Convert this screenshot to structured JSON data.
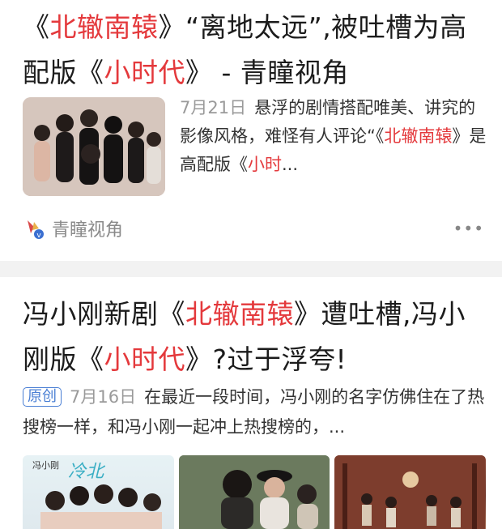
{
  "card1": {
    "title": {
      "p1": "《",
      "h1": "北辙南辕",
      "p2": "》“离地太远”,被吐槽为高配版《",
      "h2": "小时代",
      "p3": "》 - 青瞳视角"
    },
    "date": "7月21日",
    "snippet": {
      "s1": "悬浮的剧情搭配唯美、讲究的影像风格，难怪有人评论“《",
      "h1": "北辙南辕",
      "s2": "》是高配版《",
      "h2": "小时",
      "s3": "..."
    },
    "source": "青瞳视角",
    "more_label": "•••",
    "thumbnail_icon": "poster-photo"
  },
  "card2": {
    "title": {
      "p1": "冯小刚新剧《",
      "h1": "北辙南辕",
      "p2": "》遭吐槽,冯小刚版《",
      "h2": "小时代",
      "p3": "》?过于浮夸!"
    },
    "badge": "原创",
    "date": "7月16日",
    "snippet": "在最近一段时间，冯小刚的名字仿佛住在了热搜榜一样，和冯小刚一起冲上热搜榜的，...",
    "images": [
      "poster-photo",
      "still-photo",
      "still-photo"
    ],
    "poster_caption": "冯小刚"
  },
  "colors": {
    "highlight": "#e4393c",
    "badge": "#4a7fd4",
    "meta": "#9a9a9a",
    "divider": "#f2f2f2"
  }
}
